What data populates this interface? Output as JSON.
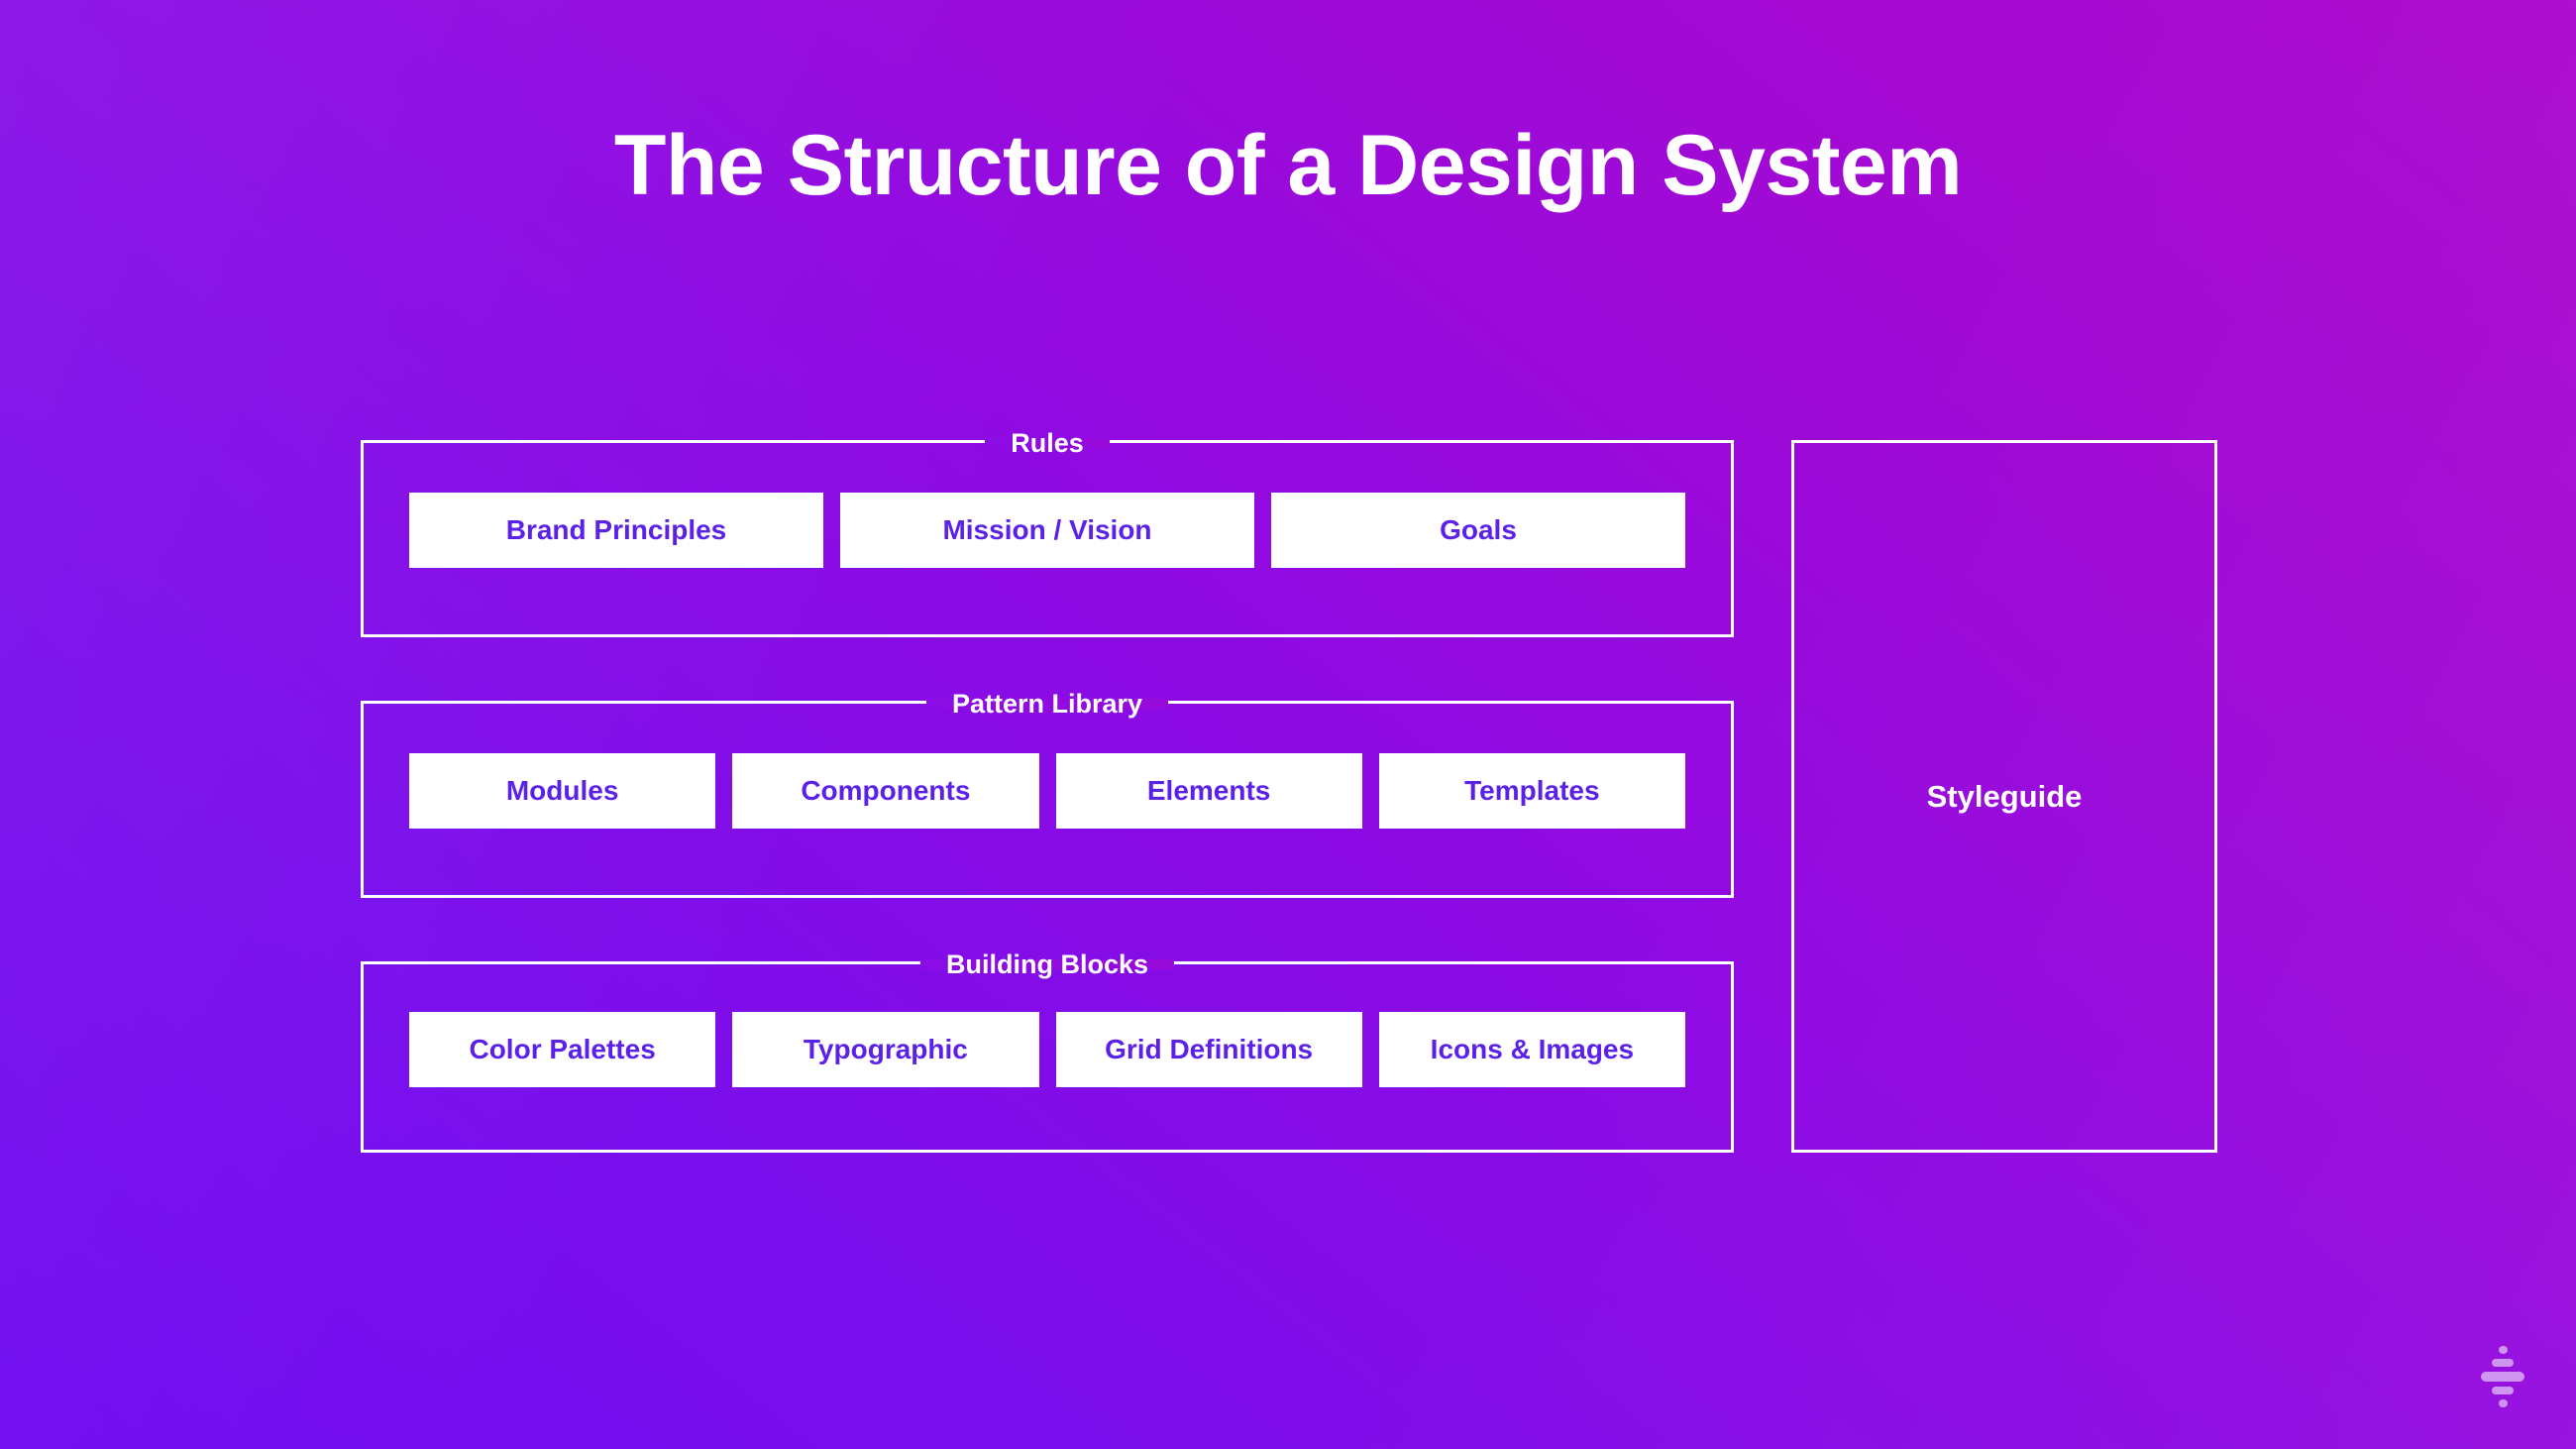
{
  "slide": {
    "title": "The Structure of a Design System",
    "background_from": "#6f0bf0",
    "background_to": "#ac0bcd",
    "card_text_color": "#5b21e8",
    "line_color": "#ffffff"
  },
  "groups": [
    {
      "label": "Rules",
      "cards": [
        {
          "label": "Brand Principles"
        },
        {
          "label": "Mission / Vision"
        },
        {
          "label": "Goals"
        }
      ]
    },
    {
      "label": "Pattern Library",
      "cards": [
        {
          "label": "Modules"
        },
        {
          "label": "Components"
        },
        {
          "label": "Elements"
        },
        {
          "label": "Templates"
        }
      ]
    },
    {
      "label": "Building Blocks",
      "cards": [
        {
          "label": "Color Palettes"
        },
        {
          "label": "Typographic"
        },
        {
          "label": "Grid Definitions"
        },
        {
          "label": "Icons & Images"
        }
      ]
    }
  ],
  "styleguide": {
    "label": "Styleguide"
  },
  "logo": {
    "name": "funnel-logo"
  }
}
